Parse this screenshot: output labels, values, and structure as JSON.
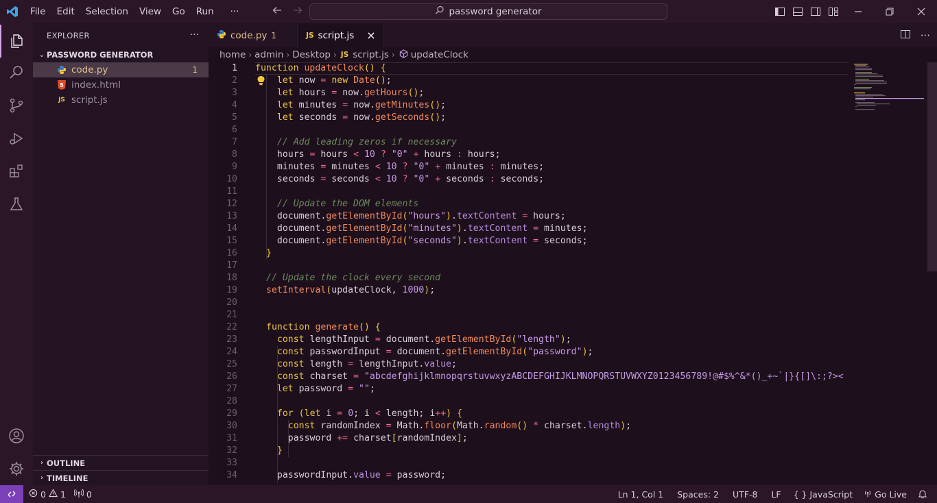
{
  "titlebar": {
    "menu": [
      "File",
      "Edit",
      "Selection",
      "View",
      "Go",
      "Run"
    ],
    "more": "···",
    "search": "password generator"
  },
  "sidebar": {
    "title": "EXPLORER",
    "folder": "PASSWORD GENERATOR",
    "files": [
      {
        "name": "code.py",
        "type": "py",
        "badge": "1"
      },
      {
        "name": "index.html",
        "type": "html",
        "badge": ""
      },
      {
        "name": "script.js",
        "type": "js",
        "badge": ""
      }
    ],
    "outline": "OUTLINE",
    "timeline": "TIMELINE"
  },
  "tabs": [
    {
      "label": "code.py",
      "badge": "1"
    },
    {
      "label": "script.js",
      "close": "×"
    }
  ],
  "breadcrumb": [
    "home",
    "admin",
    "Desktop",
    "script.js",
    "updateClock"
  ],
  "editor": {
    "lines": [
      "function updateClock() {",
      "  let now = new Date();",
      "  let hours = now.getHours();",
      "  let minutes = now.getMinutes();",
      "  let seconds = now.getSeconds();",
      "",
      "  // Add leading zeros if necessary",
      "  hours = hours < 10 ? \"0\" + hours : hours;",
      "  minutes = minutes < 10 ? \"0\" + minutes : minutes;",
      "  seconds = seconds < 10 ? \"0\" + seconds : seconds;",
      "",
      "  // Update the DOM elements",
      "  document.getElementById(\"hours\").textContent = hours;",
      "  document.getElementById(\"minutes\").textContent = minutes;",
      "  document.getElementById(\"seconds\").textContent = seconds;",
      "}",
      "",
      "// Update the clock every second",
      "setInterval(updateClock, 1000);",
      "",
      "",
      "function generate() {",
      "  const lengthInput = document.getElementById(\"length\");",
      "  const passwordInput = document.getElementById(\"password\");",
      "  const length = lengthInput.value;",
      "  const charset = \"abcdefghijklmnopqrstuvwxyzABCDEFGHIJKLMNOPQRSTUVWXYZ0123456789!@#$%^&*()_+~`|}{[]\\:;?><",
      "  let password = \"\";",
      "",
      "  for (let i = 0; i < length; i++) {",
      "    const randomIndex = Math.floor(Math.random() * charset.length);",
      "    password += charset[randomIndex];",
      "  }",
      "",
      "  passwordInput.value = password;"
    ]
  },
  "statusbar": {
    "errors": "0",
    "warnings": "1",
    "ports": "0",
    "position": "Ln 1, Col 1",
    "spaces": "Spaces: 2",
    "encoding": "UTF-8",
    "eol": "LF",
    "language": "JavaScript",
    "golive": "Go Live"
  },
  "colors": {
    "background": "#1e0f1c",
    "sidebar": "#241322",
    "keyword": "#e8c547",
    "function": "#f08a5d",
    "string": "#c59be8",
    "comment": "#6a8a5c",
    "remote": "#7b3fb8"
  },
  "icons": [
    "vscode-logo",
    "files-icon",
    "search-icon",
    "source-control-icon",
    "run-debug-icon",
    "extensions-icon",
    "testing-icon",
    "account-icon",
    "gear-icon",
    "lightbulb-icon",
    "bell-icon"
  ]
}
